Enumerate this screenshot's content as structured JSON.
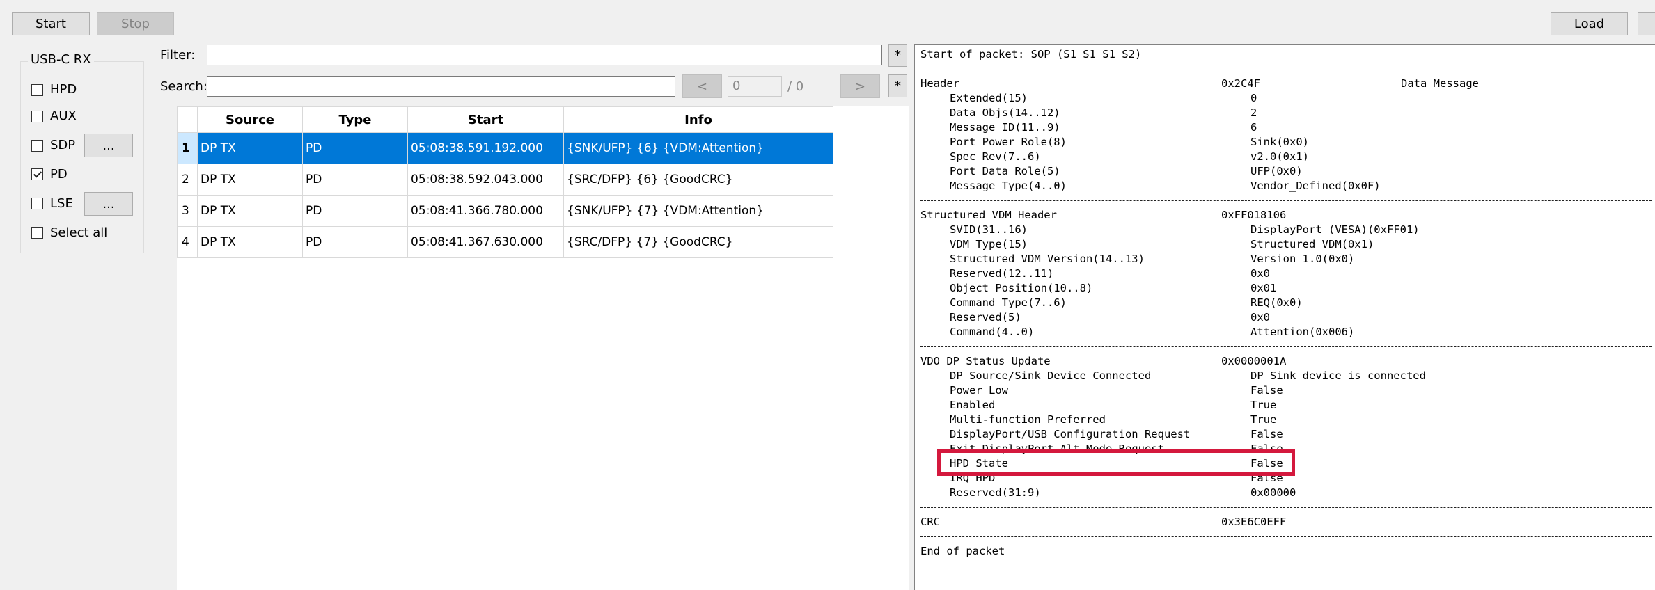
{
  "toolbar": {
    "start_label": "Start",
    "stop_label": "Stop",
    "load_label": "Load"
  },
  "rx_panel": {
    "title": "USB-C RX",
    "items": [
      {
        "label": "HPD",
        "checked": false
      },
      {
        "label": "AUX",
        "checked": false
      },
      {
        "label": "SDP",
        "checked": false,
        "more": "..."
      },
      {
        "label": "PD",
        "checked": true
      },
      {
        "label": "LSE",
        "checked": false,
        "more": "..."
      },
      {
        "label": "Select all",
        "checked": false
      }
    ]
  },
  "filter": {
    "label": "Filter:",
    "value": "",
    "star": "*"
  },
  "search": {
    "label": "Search:",
    "value": "",
    "prev": "<",
    "index": "0",
    "total": "/ 0",
    "next": ">",
    "star": "*"
  },
  "table": {
    "columns": [
      "Source",
      "Type",
      "Start",
      "Info"
    ],
    "rows": [
      {
        "num": "1",
        "source": "DP TX",
        "type": "PD",
        "start": "05:08:38.591.192.000",
        "info": "{SNK/UFP} {6} {VDM:Attention}",
        "selected": true
      },
      {
        "num": "2",
        "source": "DP TX",
        "type": "PD",
        "start": "05:08:38.592.043.000",
        "info": "{SRC/DFP} {6} {GoodCRC}",
        "selected": false
      },
      {
        "num": "3",
        "source": "DP TX",
        "type": "PD",
        "start": "05:08:41.366.780.000",
        "info": "{SNK/UFP} {7} {VDM:Attention}",
        "selected": false
      },
      {
        "num": "4",
        "source": "DP TX",
        "type": "PD",
        "start": "05:08:41.367.630.000",
        "info": "{SRC/DFP} {7} {GoodCRC}",
        "selected": false
      }
    ]
  },
  "detail": {
    "start": "Start of packet: SOP (S1 S1 S1 S2)",
    "header": {
      "name": "Header",
      "value": "0x2C4F",
      "extra": "Data Message"
    },
    "header_fields": [
      {
        "name": "Extended(15)",
        "value": "0"
      },
      {
        "name": "Data Objs(14..12)",
        "value": "2"
      },
      {
        "name": "Message ID(11..9)",
        "value": "6"
      },
      {
        "name": "Port Power Role(8)",
        "value": "Sink(0x0)"
      },
      {
        "name": "Spec Rev(7..6)",
        "value": "v2.0(0x1)"
      },
      {
        "name": "Port Data Role(5)",
        "value": "UFP(0x0)"
      },
      {
        "name": "Message Type(4..0)",
        "value": "Vendor_Defined(0x0F)"
      }
    ],
    "vdm_header": {
      "name": "Structured VDM Header",
      "value": "0xFF018106"
    },
    "vdm_fields": [
      {
        "name": "SVID(31..16)",
        "value": "DisplayPort (VESA)(0xFF01)"
      },
      {
        "name": "VDM Type(15)",
        "value": "Structured VDM(0x1)"
      },
      {
        "name": "Structured VDM Version(14..13)",
        "value": "Version 1.0(0x0)"
      },
      {
        "name": "Reserved(12..11)",
        "value": "0x0"
      },
      {
        "name": "Object Position(10..8)",
        "value": "0x01"
      },
      {
        "name": "Command Type(7..6)",
        "value": "REQ(0x0)"
      },
      {
        "name": "Reserved(5)",
        "value": "0x0"
      },
      {
        "name": "Command(4..0)",
        "value": "Attention(0x006)"
      }
    ],
    "vdo": {
      "name": "VDO DP Status Update",
      "value": "0x0000001A"
    },
    "vdo_fields": [
      {
        "name": "DP Source/Sink Device Connected",
        "value": "DP Sink device is connected"
      },
      {
        "name": "Power Low",
        "value": "False"
      },
      {
        "name": "Enabled",
        "value": "True"
      },
      {
        "name": "Multi-function Preferred",
        "value": "True"
      },
      {
        "name": "DisplayPort/USB Configuration Request",
        "value": "False"
      },
      {
        "name": "Exit DisplayPort Alt Mode Request",
        "value": "False"
      },
      {
        "name": "HPD State",
        "value": "False"
      },
      {
        "name": "IRQ_HPD",
        "value": "False"
      },
      {
        "name": "Reserved(31:9)",
        "value": "0x00000"
      }
    ],
    "crc": {
      "name": "CRC",
      "value": "0x3E6C0EFF"
    },
    "end": "End of packet"
  },
  "colors": {
    "selection": "#0078d7",
    "highlight": "#d4183d"
  }
}
